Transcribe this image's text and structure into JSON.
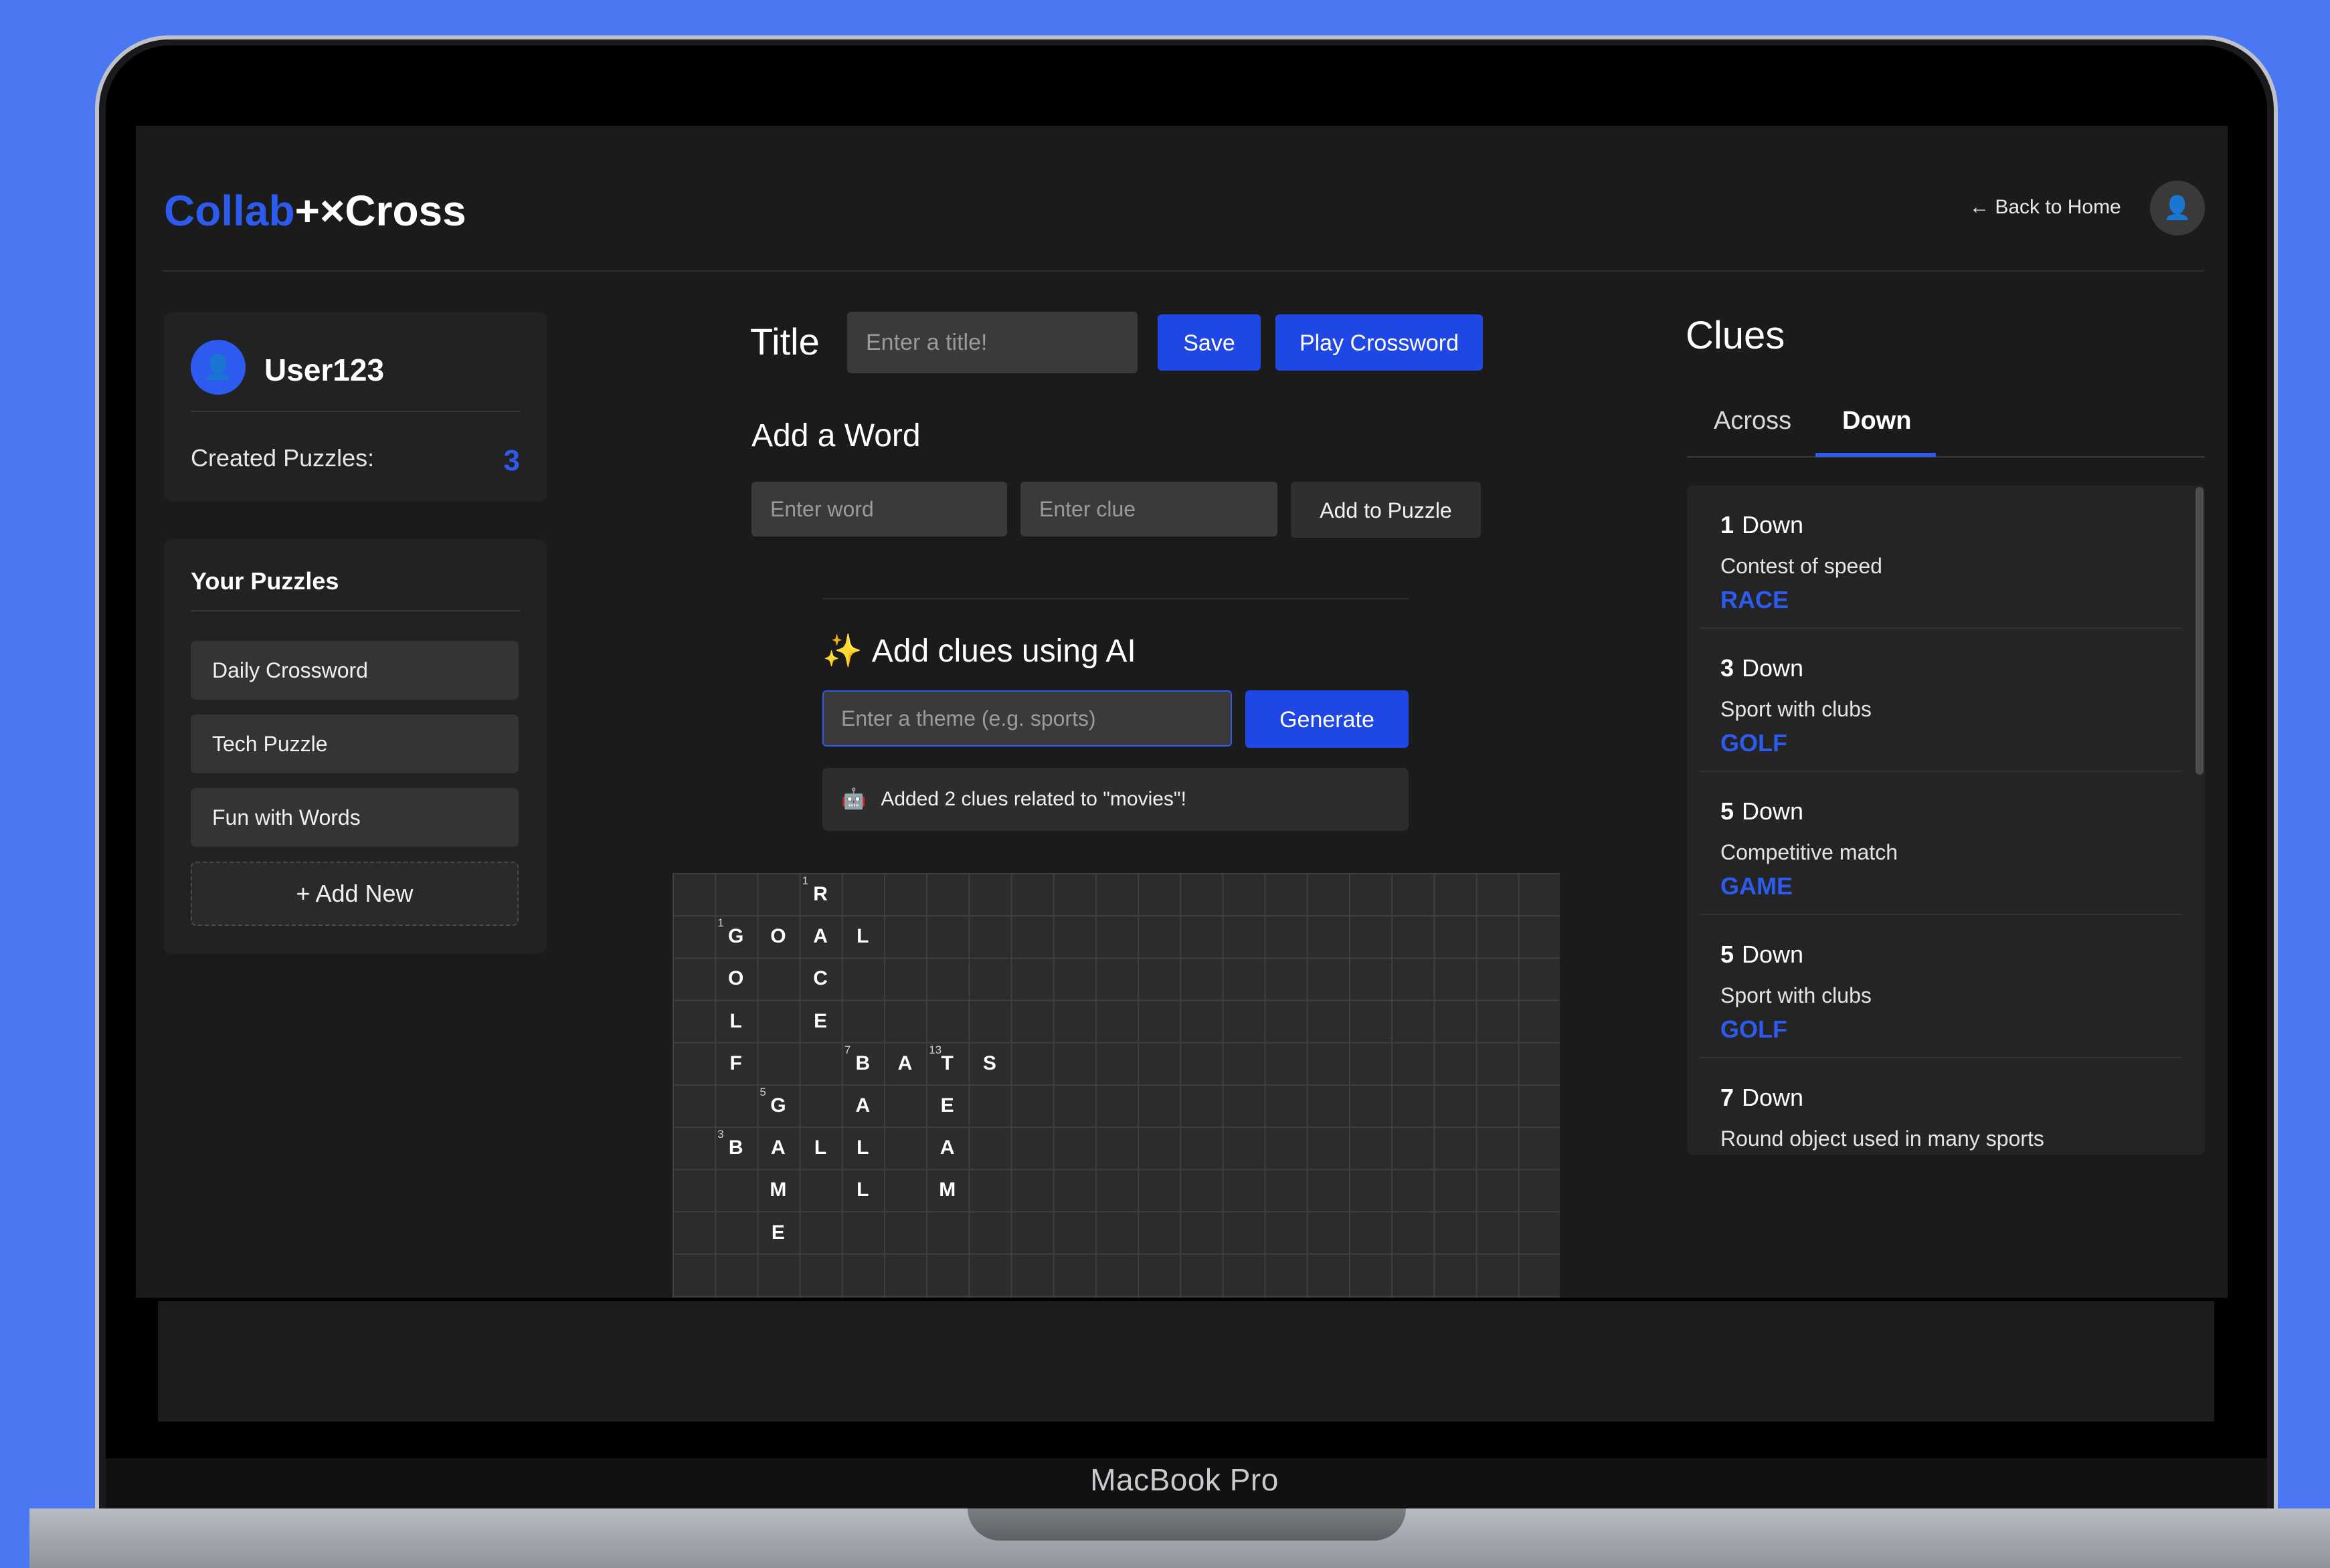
{
  "device": {
    "brand": "MacBook Pro"
  },
  "header": {
    "logo_part1": "Collab",
    "logo_part2": "+×Cross",
    "back_link": "← Back to Home"
  },
  "sidebar": {
    "username": "User123",
    "created_label": "Created Puzzles:",
    "created_count": "3",
    "puzzles_heading": "Your Puzzles",
    "puzzles": [
      "Daily Crossword",
      "Tech Puzzle",
      "Fun with Words"
    ],
    "add_new": "+  Add New"
  },
  "editor": {
    "title_label": "Title",
    "title_placeholder": "Enter a title!",
    "save": "Save",
    "play": "Play Crossword",
    "add_word_heading": "Add a Word",
    "word_placeholder": "Enter word",
    "clue_placeholder": "Enter clue",
    "add_to_puzzle": "Add to Puzzle",
    "ai_heading": "Add clues using AI",
    "theme_placeholder": "Enter a theme (e.g. sports)",
    "generate": "Generate",
    "status": "Added 2 clues related to \"movies\"!"
  },
  "grid": {
    "letters": [
      {
        "r": 0,
        "c": 3,
        "ch": "R"
      },
      {
        "r": 1,
        "c": 1,
        "ch": "G"
      },
      {
        "r": 1,
        "c": 2,
        "ch": "O"
      },
      {
        "r": 1,
        "c": 3,
        "ch": "A"
      },
      {
        "r": 1,
        "c": 4,
        "ch": "L"
      },
      {
        "r": 2,
        "c": 1,
        "ch": "O"
      },
      {
        "r": 2,
        "c": 3,
        "ch": "C"
      },
      {
        "r": 3,
        "c": 1,
        "ch": "L"
      },
      {
        "r": 3,
        "c": 3,
        "ch": "E"
      },
      {
        "r": 4,
        "c": 1,
        "ch": "F"
      },
      {
        "r": 4,
        "c": 4,
        "ch": "B"
      },
      {
        "r": 4,
        "c": 5,
        "ch": "A"
      },
      {
        "r": 4,
        "c": 6,
        "ch": "T"
      },
      {
        "r": 4,
        "c": 7,
        "ch": "S"
      },
      {
        "r": 5,
        "c": 2,
        "ch": "G"
      },
      {
        "r": 5,
        "c": 4,
        "ch": "A"
      },
      {
        "r": 5,
        "c": 6,
        "ch": "E"
      },
      {
        "r": 6,
        "c": 1,
        "ch": "B"
      },
      {
        "r": 6,
        "c": 2,
        "ch": "A"
      },
      {
        "r": 6,
        "c": 3,
        "ch": "L"
      },
      {
        "r": 6,
        "c": 4,
        "ch": "L"
      },
      {
        "r": 6,
        "c": 6,
        "ch": "A"
      },
      {
        "r": 7,
        "c": 2,
        "ch": "M"
      },
      {
        "r": 7,
        "c": 4,
        "ch": "L"
      },
      {
        "r": 7,
        "c": 6,
        "ch": "M"
      },
      {
        "r": 8,
        "c": 2,
        "ch": "E"
      }
    ],
    "numbers": [
      {
        "r": 0,
        "c": 3,
        "n": "1"
      },
      {
        "r": 1,
        "c": 1,
        "n": "1"
      },
      {
        "r": 4,
        "c": 4,
        "n": "7"
      },
      {
        "r": 4,
        "c": 6,
        "n": "13"
      },
      {
        "r": 5,
        "c": 2,
        "n": "5"
      },
      {
        "r": 6,
        "c": 1,
        "n": "3"
      }
    ]
  },
  "clues": {
    "heading": "Clues",
    "tabs": [
      "Across",
      "Down"
    ],
    "active_tab": "Down",
    "items": [
      {
        "num": "1",
        "dir": "Down",
        "text": "Contest of speed",
        "answer": "RACE"
      },
      {
        "num": "3",
        "dir": "Down",
        "text": "Sport with clubs",
        "answer": "GOLF"
      },
      {
        "num": "5",
        "dir": "Down",
        "text": "Competitive match",
        "answer": "GAME"
      },
      {
        "num": "5",
        "dir": "Down",
        "text": "Sport with clubs",
        "answer": "GOLF"
      },
      {
        "num": "7",
        "dir": "Down",
        "text": "Round object used in many sports",
        "answer": ""
      }
    ]
  },
  "colors": {
    "accent": "#2d5bf0",
    "button": "#1f47e6",
    "background": "#4b77f3"
  }
}
